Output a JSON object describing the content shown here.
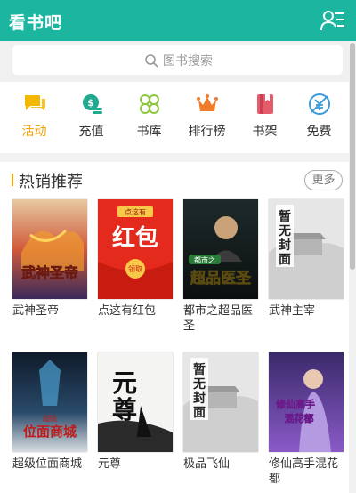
{
  "app": {
    "title": "看书吧"
  },
  "search": {
    "placeholder": "图书搜索"
  },
  "nav": [
    {
      "label": "活动",
      "icon": "chat-bubble-icon",
      "active": true
    },
    {
      "label": "充值",
      "icon": "coins-icon",
      "active": false
    },
    {
      "label": "书库",
      "icon": "clover-icon",
      "active": false
    },
    {
      "label": "排行榜",
      "icon": "crown-icon",
      "active": false
    },
    {
      "label": "书架",
      "icon": "bookmark-book-icon",
      "active": false
    },
    {
      "label": "免费",
      "icon": "free-icon",
      "active": false
    }
  ],
  "section": {
    "title": "热销推荐",
    "more_label": "更多"
  },
  "books": [
    {
      "title": "武神圣帝",
      "cover_text": "武神圣帝"
    },
    {
      "title": "点这有红包",
      "cover_text": "红包",
      "cover_top": "点这有",
      "cover_tag": "领取"
    },
    {
      "title": "都市之超品医圣",
      "cover_text": "超品医圣",
      "cover_top": "都市之"
    },
    {
      "title": "武神主宰",
      "cover_text": "暂无封面"
    },
    {
      "title": "超级位面商城",
      "cover_text": "位面商城",
      "cover_top": "超级"
    },
    {
      "title": "元尊",
      "cover_text": "元尊"
    },
    {
      "title": "极品飞仙",
      "cover_text": "暂无封面"
    },
    {
      "title": "修仙高手混花都",
      "cover_text": "修仙高手混花都"
    }
  ],
  "colors": {
    "brand": "#1cb5a0",
    "accent": "#f4a300"
  }
}
